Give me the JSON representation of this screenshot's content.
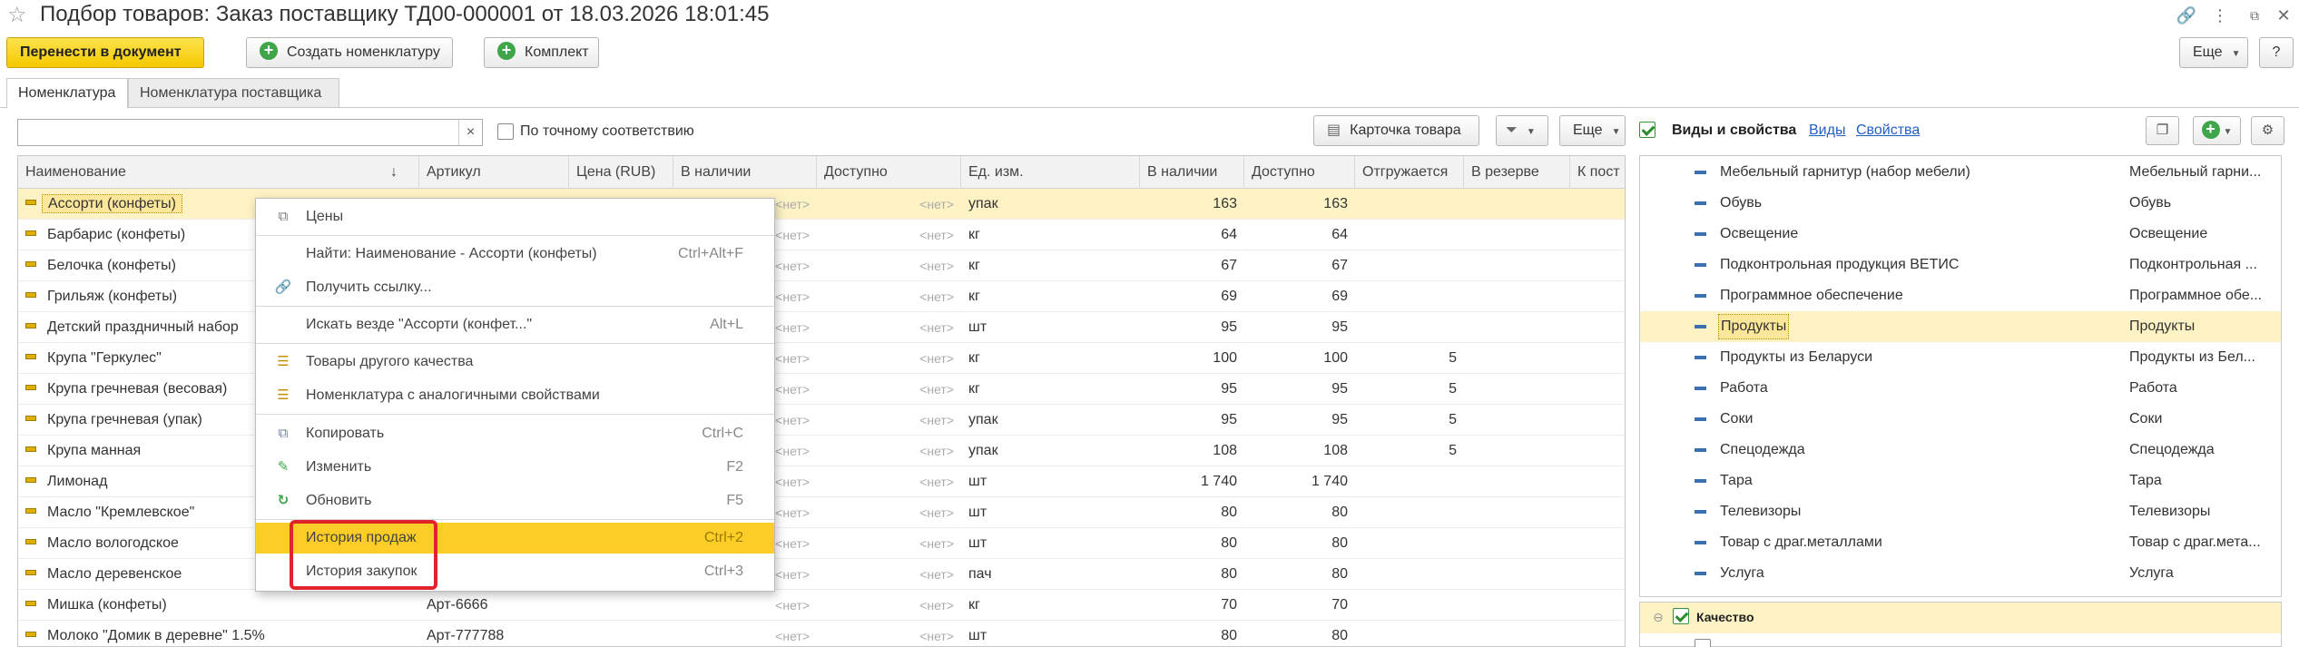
{
  "window": {
    "title": "Подбор товаров: Заказ поставщику ТД00-000001 от 18.03.2026 18:01:45"
  },
  "toolbar": {
    "transfer_label": "Перенести в документ",
    "create_label": "Создать номенклатуру",
    "kit_label": "Комплект",
    "more_label": "Еще",
    "help_label": "?"
  },
  "tabs": [
    {
      "label": "Номенклатура"
    },
    {
      "label": "Номенклатура поставщика"
    }
  ],
  "search": {
    "value": "",
    "clear": "×",
    "exact_match_label": "По точному соответствию"
  },
  "grid_toolbar": {
    "card_label": "Карточка товара",
    "more_label": "Еще"
  },
  "grid": {
    "columns": [
      "Наименование",
      "Артикул",
      "Цена (RUB)",
      "В наличии",
      "Доступно",
      "Ед. изм.",
      "В наличии",
      "Доступно",
      "Отгружается",
      "В резерве",
      "К пост"
    ],
    "sort_indicator": "↓",
    "rows": [
      {
        "name": "Ассорти (конфеты)",
        "article": "",
        "price": "",
        "inst": "<нет>",
        "avail": "<нет>",
        "unit": "упак",
        "qty": "163",
        "qavail": "163",
        "ship": "",
        "res": ""
      },
      {
        "name": "Барбарис (конфеты)",
        "article": "",
        "price": "",
        "inst": "<нет>",
        "avail": "<нет>",
        "unit": "кг",
        "qty": "64",
        "qavail": "64",
        "ship": "",
        "res": ""
      },
      {
        "name": "Белочка (конфеты)",
        "article": "",
        "price": "",
        "inst": "<нет>",
        "avail": "<нет>",
        "unit": "кг",
        "qty": "67",
        "qavail": "67",
        "ship": "",
        "res": ""
      },
      {
        "name": "Грильяж (конфеты)",
        "article": "",
        "price": "",
        "inst": "<нет>",
        "avail": "<нет>",
        "unit": "кг",
        "qty": "69",
        "qavail": "69",
        "ship": "",
        "res": ""
      },
      {
        "name": "Детский праздничный набор",
        "article": "",
        "price": "",
        "inst": "<нет>",
        "avail": "<нет>",
        "unit": "шт",
        "qty": "95",
        "qavail": "95",
        "ship": "",
        "res": ""
      },
      {
        "name": "Крупа \"Геркулес\"",
        "article": "",
        "price": "",
        "inst": "<нет>",
        "avail": "<нет>",
        "unit": "кг",
        "qty": "100",
        "qavail": "100",
        "ship": "5",
        "res": ""
      },
      {
        "name": "Крупа гречневая (весовая)",
        "article": "",
        "price": "",
        "inst": "<нет>",
        "avail": "<нет>",
        "unit": "кг",
        "qty": "95",
        "qavail": "95",
        "ship": "5",
        "res": ""
      },
      {
        "name": "Крупа гречневая (упак)",
        "article": "",
        "price": "",
        "inst": "<нет>",
        "avail": "<нет>",
        "unit": "упак",
        "qty": "95",
        "qavail": "95",
        "ship": "5",
        "res": ""
      },
      {
        "name": "Крупа манная",
        "article": "",
        "price": "",
        "inst": "<нет>",
        "avail": "<нет>",
        "unit": "упак",
        "qty": "108",
        "qavail": "108",
        "ship": "5",
        "res": ""
      },
      {
        "name": "Лимонад",
        "article": "",
        "price": "",
        "inst": "<нет>",
        "avail": "<нет>",
        "unit": "шт",
        "qty": "1 740",
        "qavail": "1 740",
        "ship": "",
        "res": ""
      },
      {
        "name": "Масло \"Кремлевское\"",
        "article": "",
        "price": "",
        "inst": "<нет>",
        "avail": "<нет>",
        "unit": "шт",
        "qty": "80",
        "qavail": "80",
        "ship": "",
        "res": ""
      },
      {
        "name": "Масло вологодское",
        "article": "",
        "price": "",
        "inst": "<нет>",
        "avail": "<нет>",
        "unit": "шт",
        "qty": "80",
        "qavail": "80",
        "ship": "",
        "res": ""
      },
      {
        "name": "Масло деревенское",
        "article": "",
        "price": "",
        "inst": "<нет>",
        "avail": "<нет>",
        "unit": "пач",
        "qty": "80",
        "qavail": "80",
        "ship": "",
        "res": ""
      },
      {
        "name": "Мишка (конфеты)",
        "article": "Арт-6666",
        "price": "",
        "inst": "<нет>",
        "avail": "<нет>",
        "unit": "кг",
        "qty": "70",
        "qavail": "70",
        "ship": "",
        "res": ""
      },
      {
        "name": "Молоко \"Домик в деревне\" 1.5%",
        "article": "Арт-777788",
        "price": "",
        "inst": "<нет>",
        "avail": "<нет>",
        "unit": "шт",
        "qty": "80",
        "qavail": "80",
        "ship": "",
        "res": ""
      }
    ]
  },
  "context_menu": {
    "items": [
      {
        "label": "Цены",
        "shortcut": "",
        "icon": "copy-icon"
      },
      {
        "label": "Найти: Наименование - Ассорти (конфеты)",
        "shortcut": "Ctrl+Alt+F",
        "icon": ""
      },
      {
        "label": "Получить ссылку...",
        "shortcut": "",
        "icon": "link-icon"
      },
      {
        "label": "Искать везде \"Ассорти (конфет...\"",
        "shortcut": "Alt+L",
        "icon": ""
      },
      {
        "label": "Товары другого качества",
        "shortcut": "",
        "icon": "list-icon"
      },
      {
        "label": "Номенклатура с аналогичными свойствами",
        "shortcut": "",
        "icon": "list-icon"
      },
      {
        "label": "Копировать",
        "shortcut": "Ctrl+C",
        "icon": "copy-icon"
      },
      {
        "label": "Изменить",
        "shortcut": "F2",
        "icon": "pencil-icon"
      },
      {
        "label": "Обновить",
        "shortcut": "F5",
        "icon": "refresh-icon"
      },
      {
        "label": "История продаж",
        "shortcut": "Ctrl+2",
        "icon": ""
      },
      {
        "label": "История закупок",
        "shortcut": "Ctrl+3",
        "icon": ""
      }
    ]
  },
  "right_panel": {
    "kinds_label": "Виды и свойства",
    "kinds_link": "Виды",
    "props_link": "Свойства",
    "rows": [
      {
        "name": "Мебельный гарнитур (набор мебели)",
        "value": "Мебельный гарни..."
      },
      {
        "name": "Обувь",
        "value": "Обувь"
      },
      {
        "name": "Освещение",
        "value": "Освещение"
      },
      {
        "name": "Подконтрольная продукция ВЕТИС",
        "value": "Подконтрольная ..."
      },
      {
        "name": "Программное обеспечение",
        "value": "Программное обе..."
      },
      {
        "name": "Продукты",
        "value": "Продукты"
      },
      {
        "name": "Продукты из Беларуси",
        "value": "Продукты из Бел..."
      },
      {
        "name": "Работа",
        "value": "Работа"
      },
      {
        "name": "Соки",
        "value": "Соки"
      },
      {
        "name": "Спецодежда",
        "value": "Спецодежда"
      },
      {
        "name": "Тара",
        "value": "Тара"
      },
      {
        "name": "Телевизоры",
        "value": "Телевизоры"
      },
      {
        "name": "Товар с драг.металлами",
        "value": "Товар с драг.мета..."
      },
      {
        "name": "Услуга",
        "value": "Услуга"
      }
    ],
    "quality_label": "Качество"
  },
  "colors": {
    "accent_yellow": "#fbcd26",
    "selection": "#fdf2c4",
    "highlight_box": "#e0242a",
    "link_blue": "#2160c4",
    "green": "#3ea54b"
  }
}
